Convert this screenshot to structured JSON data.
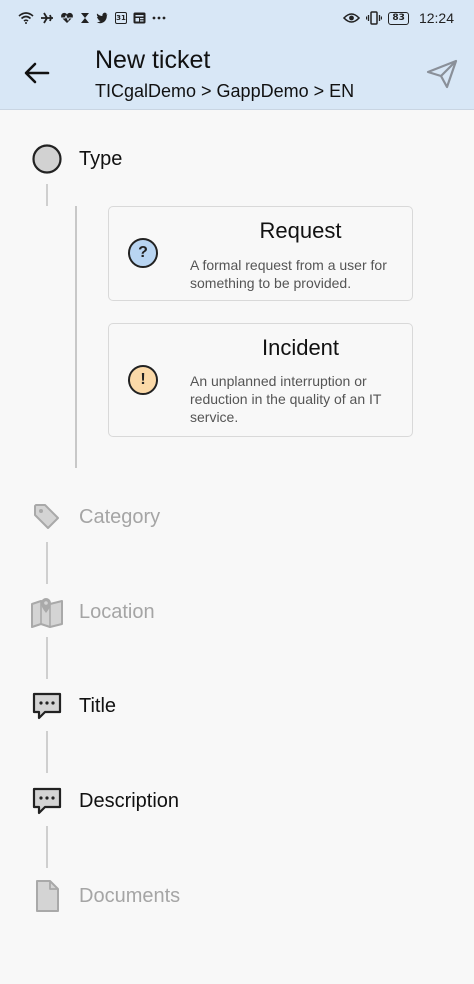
{
  "status_bar": {
    "time": "12:24",
    "battery": "83",
    "calendar_day": "31",
    "left_icons": [
      "wifi-icon",
      "airplane-icon",
      "heart-monitor-icon",
      "hourglass-icon",
      "twitter-icon",
      "calendar-icon",
      "news-icon",
      "more-icon"
    ],
    "right_icons": [
      "eye-icon",
      "vibrate-icon",
      "battery-icon"
    ]
  },
  "app_bar": {
    "title": "New ticket",
    "breadcrumb": "TICgalDemo > GappDemo > EN",
    "back_icon": "arrow-left-icon",
    "send_icon": "send-icon"
  },
  "steps": [
    {
      "label": "Type",
      "icon": "circle-icon",
      "state": "active"
    },
    {
      "label": "Category",
      "icon": "tag-icon",
      "state": "disabled"
    },
    {
      "label": "Location",
      "icon": "map-icon",
      "state": "disabled"
    },
    {
      "label": "Title",
      "icon": "chat-bubble-icon",
      "state": "active"
    },
    {
      "label": "Description",
      "icon": "chat-bubble-icon",
      "state": "active"
    },
    {
      "label": "Documents",
      "icon": "document-icon",
      "state": "disabled"
    }
  ],
  "type_options": [
    {
      "title": "Request",
      "description": "A formal request from a user for something to be provided.",
      "icon": "question-icon",
      "icon_symbol": "?",
      "icon_color": "#b9d5f2"
    },
    {
      "title": "Incident",
      "description": "An unplanned interruption or reduction in the quality of an IT service.",
      "icon": "exclamation-icon",
      "icon_symbol": "!",
      "icon_color": "#fbd9a8"
    }
  ],
  "colors": {
    "app_bar_bg": "#d8e7f6",
    "page_bg": "#f8f8f8",
    "disabled_text": "#a5a5a5"
  }
}
